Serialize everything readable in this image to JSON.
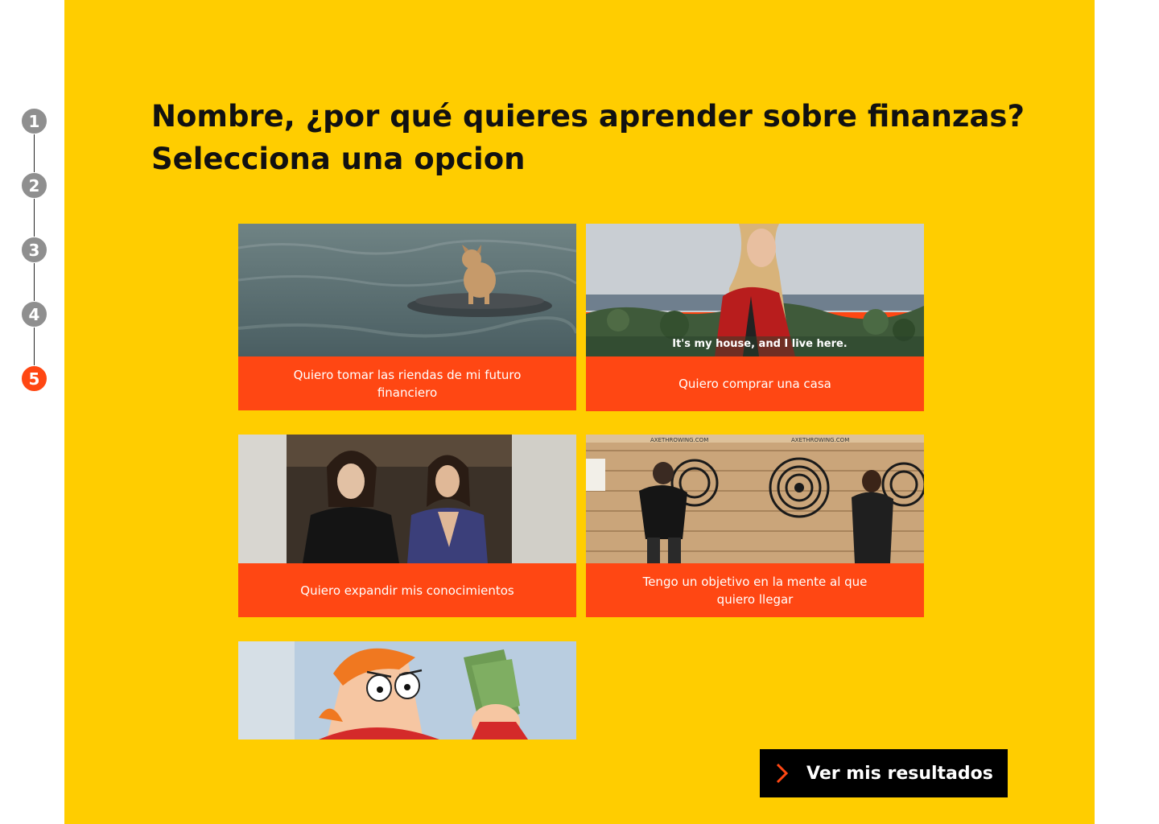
{
  "stepper": {
    "steps": [
      {
        "label": "1",
        "active": false
      },
      {
        "label": "2",
        "active": false
      },
      {
        "label": "3",
        "active": false
      },
      {
        "label": "4",
        "active": false
      },
      {
        "label": "5",
        "active": true
      }
    ]
  },
  "question": {
    "line1": "Nombre, ¿por qué quieres aprender sobre finanzas?",
    "line2": "Selecciona una opcion"
  },
  "options": [
    {
      "caption": "Quiero tomar las riendas de mi futuro financiero",
      "image_icon": "dog-on-seal-image"
    },
    {
      "caption": "Quiero comprar una casa",
      "image_icon": "woman-on-coast-image",
      "image_subtitle": "It's my house, and I live here."
    },
    {
      "caption": "Quiero expandir mis conocimientos",
      "image_icon": "two-women-image"
    },
    {
      "caption": "Tengo un objetivo en la mente al que quiero llegar",
      "image_icon": "axe-throwing-image",
      "image_signs": [
        "AXETHROWING.COM",
        "AXETHROWING.COM"
      ]
    },
    {
      "caption": "",
      "image_icon": "cartoon-money-image"
    }
  ],
  "cta": {
    "label": "Ver mis resultados",
    "icon": "chevron-right-icon"
  },
  "colors": {
    "panel": "#ffcd00",
    "accent": "#ff4713",
    "step_inactive": "#8f8f8f",
    "button": "#000000"
  }
}
